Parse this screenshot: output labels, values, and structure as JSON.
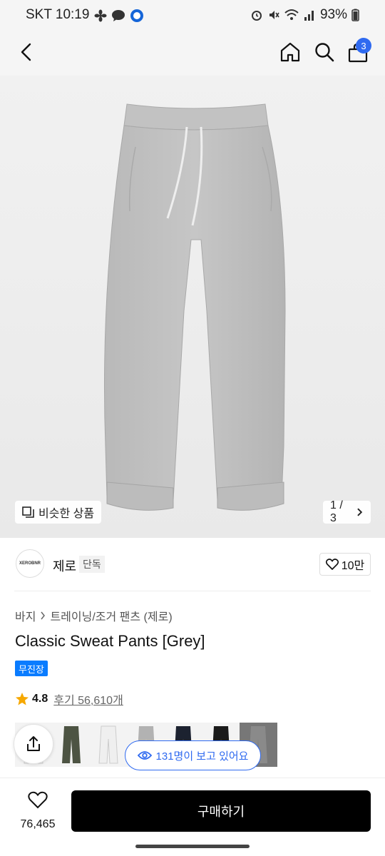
{
  "status": {
    "carrier_time": "SKT 10:19",
    "battery": "93%"
  },
  "header": {
    "cart_count": "3"
  },
  "hero": {
    "similar_label": "비슷한 상품",
    "pager": "1 / 3"
  },
  "brand": {
    "logo_text": "XEROBNR",
    "name": "제로",
    "tag": "단독",
    "likes": "10만"
  },
  "product": {
    "breadcrumb_1": "바지",
    "breadcrumb_2": "트레이닝/조거 팬츠 (제로)",
    "title": "Classic Sweat Pants [Grey]",
    "badge": "무진장",
    "rating": "4.8",
    "review_link": "후기 56,610개"
  },
  "swatches": [
    {
      "color": "#f2f2f2"
    },
    {
      "color": "#4d5443"
    },
    {
      "color": "#efefef"
    },
    {
      "color": "#b2b2b2"
    },
    {
      "color": "#1c2230"
    },
    {
      "color": "#1a1a1a"
    },
    {
      "color": "#8a8a8a"
    }
  ],
  "viewers": "131명이 보고 있어요",
  "bottom": {
    "wish_count": "76,465",
    "buy_label": "구매하기"
  }
}
